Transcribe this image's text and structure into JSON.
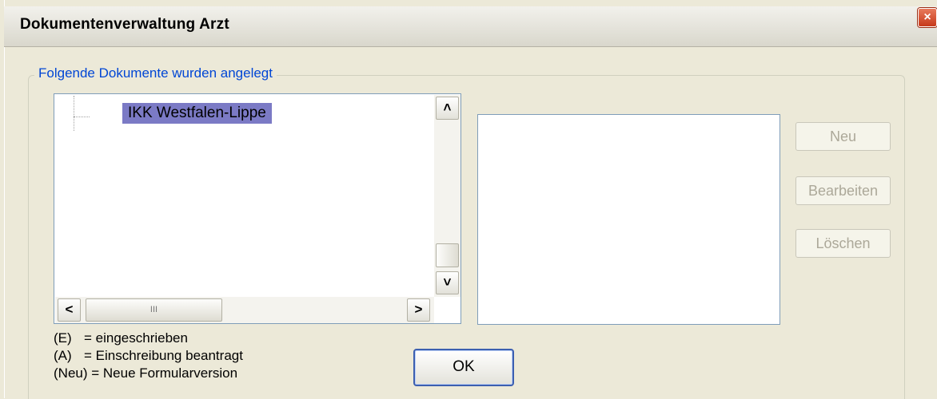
{
  "window": {
    "title": "Dokumentenverwaltung Arzt",
    "close_label": "×"
  },
  "group": {
    "label": "Folgende Dokumente wurden angelegt"
  },
  "tree": {
    "items": [
      {
        "label": "IKK Westfalen-Lippe",
        "selected": true
      }
    ],
    "scroll_up": "˄",
    "scroll_down": "˅",
    "scroll_left": "<",
    "scroll_right": ">",
    "thumb_grip": "III"
  },
  "buttons": {
    "new_label": "Neu",
    "edit_label": "Bearbeiten",
    "delete_label": "Löschen",
    "ok_label": "OK"
  },
  "legend": [
    {
      "key": "(E)",
      "text": "= eingeschrieben"
    },
    {
      "key": "(A)",
      "text": "= Einschreibung beantragt"
    },
    {
      "key": "(Neu)",
      "text": "= Neue Formularversion"
    }
  ],
  "colors": {
    "dialog_bg": "#ECE9D8",
    "group_label": "#0046D5",
    "selection": "#7B7AC5",
    "disabled_text": "#ACA899"
  }
}
